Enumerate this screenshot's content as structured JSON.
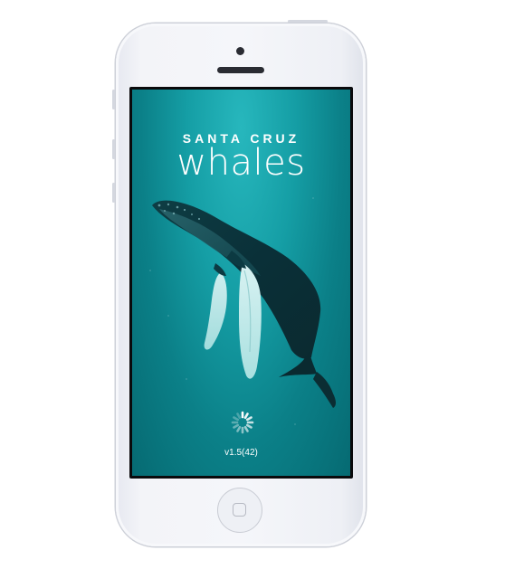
{
  "app": {
    "brand_top": "SANTA CRUZ",
    "brand_main": "whales",
    "version": "v1.5(42)"
  },
  "device": {
    "model": "iPhone",
    "color": "white"
  },
  "icons": {
    "loading": "loading-spinner-icon",
    "home": "home-button"
  },
  "colors": {
    "screen_top": "#27b7bd",
    "screen_bottom": "#066a72",
    "text": "#ffffff",
    "device_body": "#f3f4f8"
  }
}
